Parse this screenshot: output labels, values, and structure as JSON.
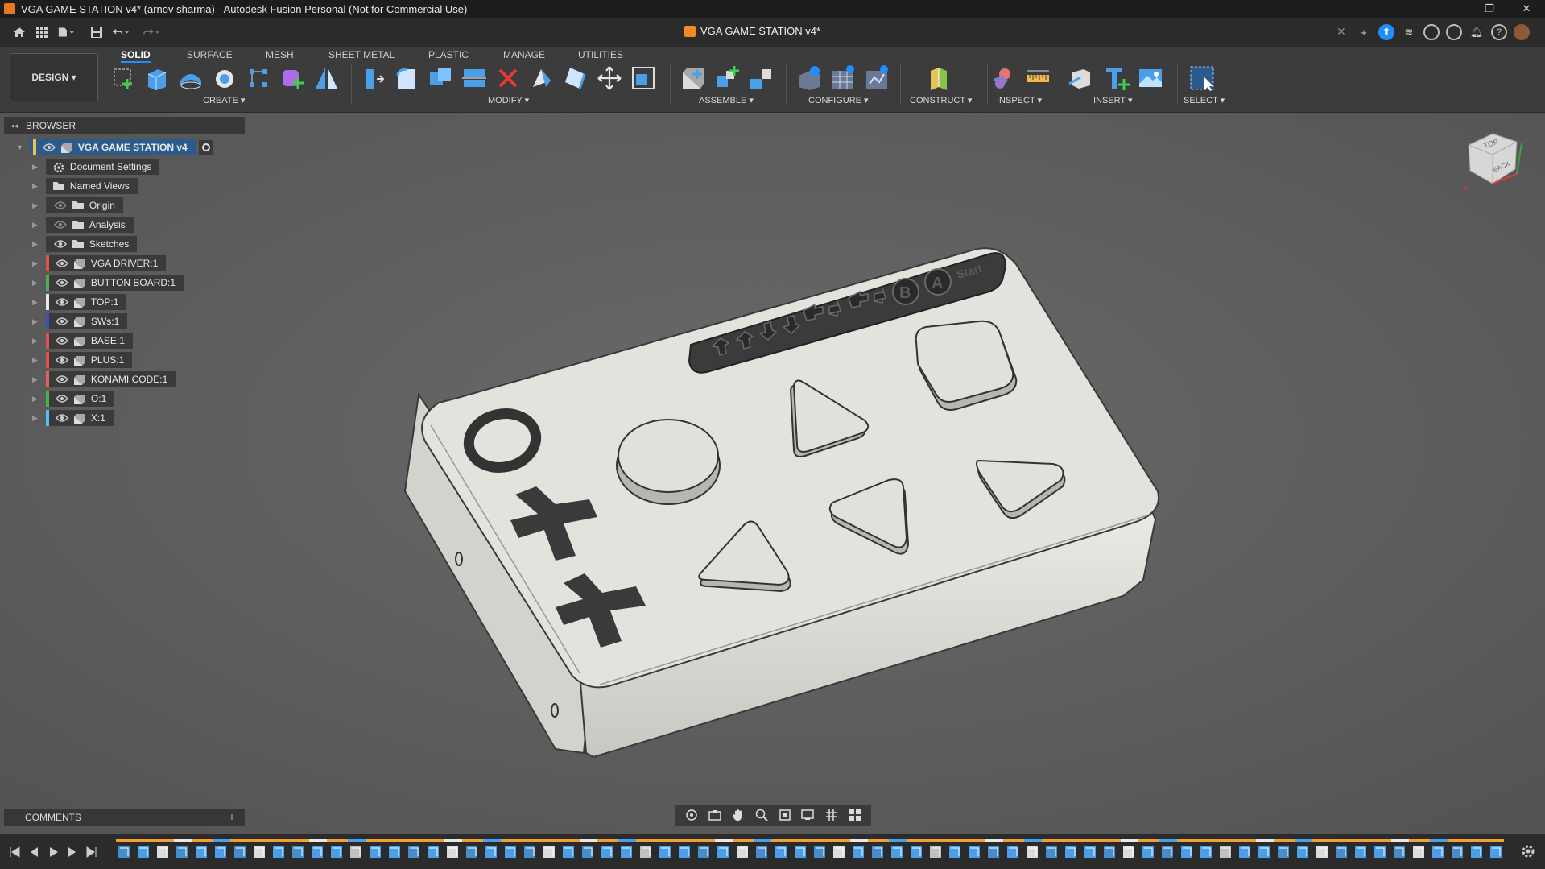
{
  "titlebar": {
    "title": "VGA GAME STATION v4* (arnov sharma) - Autodesk Fusion Personal (Not for Commercial Use)",
    "minimize": "–",
    "restore": "❐",
    "close": "✕"
  },
  "document_tab": {
    "label": "VGA GAME STATION v4*",
    "close": "✕"
  },
  "workspace": {
    "label": "DESIGN ▾"
  },
  "ribbon_tabs": [
    {
      "label": "SOLID",
      "active": true
    },
    {
      "label": "SURFACE"
    },
    {
      "label": "MESH"
    },
    {
      "label": "SHEET METAL"
    },
    {
      "label": "PLASTIC"
    },
    {
      "label": "MANAGE"
    },
    {
      "label": "UTILITIES"
    }
  ],
  "ribbon_groups": {
    "create": "CREATE ▾",
    "modify": "MODIFY ▾",
    "assemble": "ASSEMBLE ▾",
    "configure": "CONFIGURE ▾",
    "construct": "CONSTRUCT ▾",
    "inspect": "INSPECT ▾",
    "insert": "INSERT ▾",
    "select": "SELECT ▾"
  },
  "browser": {
    "title": "BROWSER",
    "collapse": "–",
    "root": "VGA GAME STATION v4",
    "items": [
      {
        "label": "Document Settings",
        "color": ""
      },
      {
        "label": "Named Views",
        "color": ""
      },
      {
        "label": "Origin",
        "color": ""
      },
      {
        "label": "Analysis",
        "color": ""
      },
      {
        "label": "Sketches",
        "color": ""
      },
      {
        "label": "VGA DRIVER:1",
        "color": "#e05050"
      },
      {
        "label": "BUTTON BOARD:1",
        "color": "#4caf50"
      },
      {
        "label": "TOP:1",
        "color": "#e8e8e8"
      },
      {
        "label": "SWs:1",
        "color": "#3f51b5"
      },
      {
        "label": "BASE:1",
        "color": "#e05050"
      },
      {
        "label": "PLUS:1",
        "color": "#e05050"
      },
      {
        "label": "KONAMI CODE:1",
        "color": "#e06060"
      },
      {
        "label": "O:1",
        "color": "#4caf50"
      },
      {
        "label": "X:1",
        "color": "#4fc3f7"
      }
    ]
  },
  "comments": {
    "title": "COMMENTS",
    "add": "+"
  },
  "model": {
    "start_label": "Start",
    "button_b": "B",
    "button_a": "A"
  },
  "viewcube": {
    "top": "TOP",
    "back": "BACK"
  }
}
